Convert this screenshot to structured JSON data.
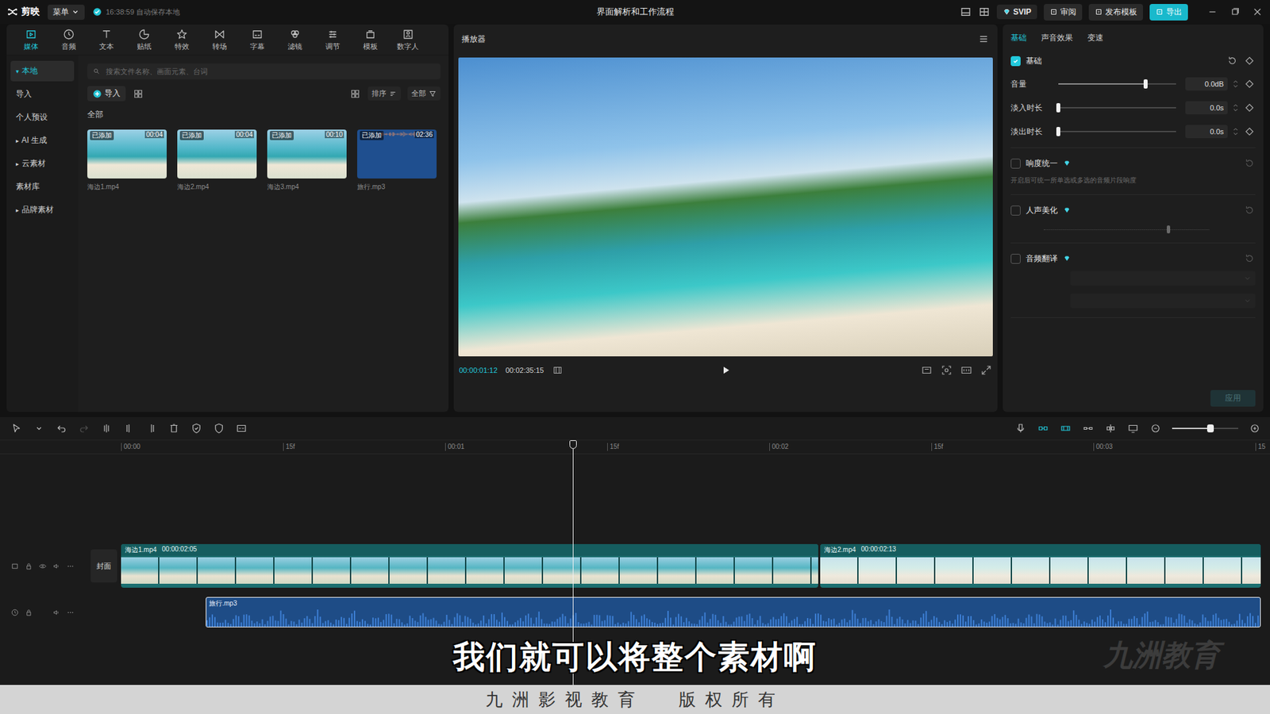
{
  "titlebar": {
    "app_name": "剪映",
    "menu": "菜单",
    "autosave": "16:38:59 自动保存本地",
    "title": "界面解析和工作流程",
    "buttons": [
      {
        "label": "SVIP",
        "kind": "vip"
      },
      {
        "label": "审阅",
        "kind": "plain"
      },
      {
        "label": "发布模板",
        "kind": "plain"
      },
      {
        "label": "导出",
        "kind": "primary"
      }
    ]
  },
  "tool_tabs": [
    {
      "label": "媒体",
      "selected": true
    },
    {
      "label": "音频",
      "selected": false
    },
    {
      "label": "文本",
      "selected": false
    },
    {
      "label": "贴纸",
      "selected": false
    },
    {
      "label": "特效",
      "selected": false
    },
    {
      "label": "转场",
      "selected": false
    },
    {
      "label": "字幕",
      "selected": false
    },
    {
      "label": "滤镜",
      "selected": false
    },
    {
      "label": "调节",
      "selected": false
    },
    {
      "label": "模板",
      "selected": false
    },
    {
      "label": "数字人",
      "selected": false
    }
  ],
  "media_sidebar": [
    {
      "label": "本地",
      "arrow": "▾",
      "selected": true
    },
    {
      "label": "导入",
      "arrow": "",
      "selected": false
    },
    {
      "label": "个人预设",
      "arrow": "",
      "selected": false
    },
    {
      "label": "AI 生成",
      "arrow": "▸",
      "selected": false
    },
    {
      "label": "云素材",
      "arrow": "▸",
      "selected": false
    },
    {
      "label": "素材库",
      "arrow": "",
      "selected": false
    },
    {
      "label": "品牌素材",
      "arrow": "▸",
      "selected": false
    }
  ],
  "media_search": {
    "placeholder": "搜索文件名称、画面元素、台词"
  },
  "media_toolbar": {
    "import": "导入",
    "sort": "排序",
    "filter": "全部"
  },
  "media_group": "全部",
  "media_items": [
    {
      "name": "海边1.mp4",
      "duration": "00:04",
      "badge": "已添加",
      "kind": "video"
    },
    {
      "name": "海边2.mp4",
      "duration": "00:04",
      "badge": "已添加",
      "kind": "video"
    },
    {
      "name": "海边3.mp4",
      "duration": "00:10",
      "badge": "已添加",
      "kind": "video"
    },
    {
      "name": "旅行.mp3",
      "duration": "02:36",
      "badge": "已添加",
      "kind": "audio"
    }
  ],
  "player": {
    "title": "播放器",
    "current": "00:00:01:12",
    "total": "00:02:35:15"
  },
  "inspector": {
    "tabs": [
      {
        "label": "基础",
        "selected": true
      },
      {
        "label": "声音效果",
        "selected": false
      },
      {
        "label": "变速",
        "selected": false
      }
    ],
    "section": {
      "label": "基础",
      "checked": true
    },
    "sliders": [
      {
        "label": "音量",
        "level": 0.74,
        "value": "0.0dB"
      },
      {
        "label": "淡入时长",
        "level": 0,
        "value": "0.0s"
      },
      {
        "label": "淡出时长",
        "level": 0,
        "value": "0.0s"
      }
    ],
    "options": [
      {
        "label": "响度统一",
        "checked": false,
        "vip": true,
        "kind": "plain",
        "description": "开启后可统一所单选或多选的音频片段响度"
      },
      {
        "label": "人声美化",
        "checked": false,
        "vip": true,
        "kind": "slider",
        "level": 0.75
      },
      {
        "label": "音频翻译",
        "checked": false,
        "vip": true,
        "kind": "select"
      }
    ],
    "apply": {
      "label": "应用",
      "disabled": true
    }
  },
  "timeline": {
    "ruler": [
      "00:00",
      "15f",
      "00:01",
      "15f",
      "00:02",
      "15f",
      "00:03",
      "15"
    ],
    "zoom_level": 0.58,
    "cover": "封面",
    "video_clips": [
      {
        "name": "海边1.mp4",
        "duration": "00:00:02:05"
      },
      {
        "name": "海边2.mp4",
        "duration": "00:00:02:13"
      }
    ],
    "audio_clips": [
      {
        "name": "旅行.mp3",
        "selected": true
      }
    ]
  },
  "overlay": {
    "caption": "我们就可以将整个素材啊",
    "watermark": "九洲教育",
    "footer": "九洲影视教育 版权所有"
  }
}
